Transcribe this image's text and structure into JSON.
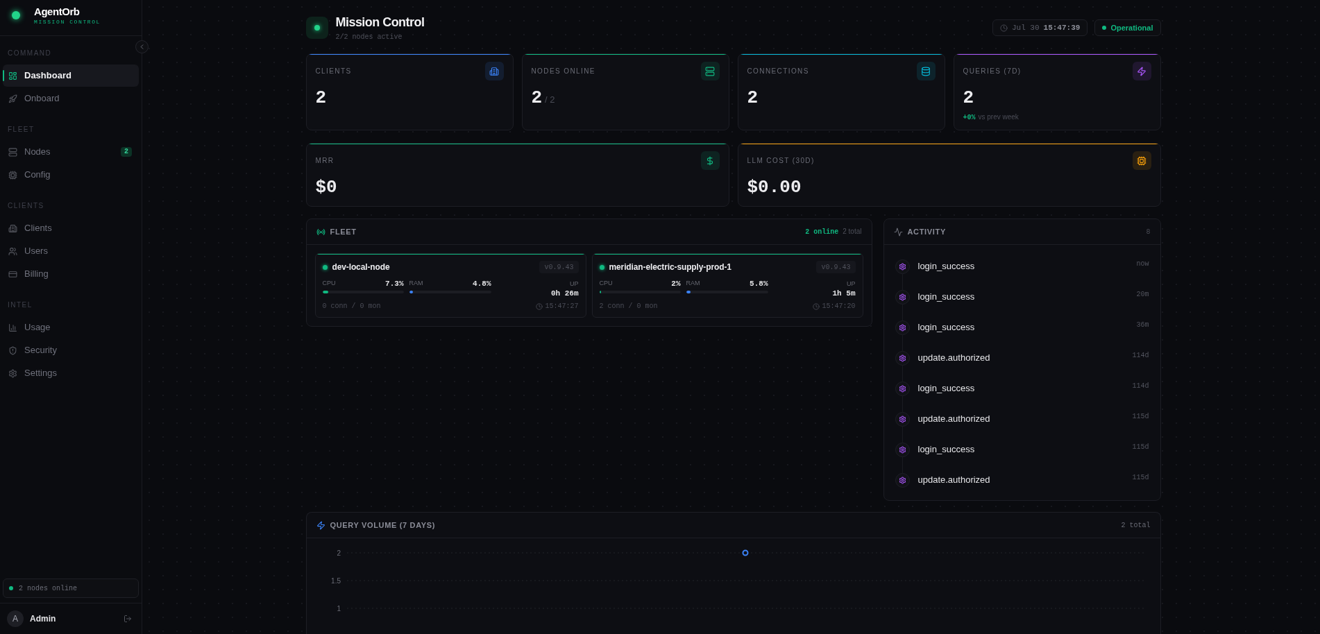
{
  "sidebar": {
    "brand": {
      "name": "AgentOrb",
      "tagline": "MISSION CONTROL"
    },
    "sections": [
      {
        "title": "COMMAND",
        "items": [
          {
            "label": "Dashboard",
            "selected": true
          },
          {
            "label": "Onboard",
            "selected": false
          }
        ]
      },
      {
        "title": "FLEET",
        "items": [
          {
            "label": "Nodes",
            "selected": false,
            "badge": "2"
          },
          {
            "label": "Config",
            "selected": false
          }
        ]
      },
      {
        "title": "CLIENTS",
        "items": [
          {
            "label": "Clients",
            "selected": false
          },
          {
            "label": "Users",
            "selected": false
          },
          {
            "label": "Billing",
            "selected": false
          }
        ]
      },
      {
        "title": "INTEL",
        "items": [
          {
            "label": "Usage",
            "selected": false
          },
          {
            "label": "Security",
            "selected": false
          },
          {
            "label": "Settings",
            "selected": false
          }
        ]
      }
    ],
    "status": "2 nodes online",
    "user": {
      "initial": "A",
      "name": "Admin"
    }
  },
  "header": {
    "title": "Mission Control",
    "subtitle": "2/2 nodes active",
    "date": "Jul 30",
    "time": "15:47:39",
    "status": "Operational"
  },
  "metrics": [
    {
      "label": "CLIENTS",
      "value": "2",
      "color": "#3b82f6"
    },
    {
      "label": "NODES ONLINE",
      "value": "2",
      "suffix": "/ 2",
      "color": "#10b981"
    },
    {
      "label": "CONNECTIONS",
      "value": "2",
      "color": "#06b6d4"
    },
    {
      "label": "QUERIES (7D)",
      "value": "2",
      "change": "+0%",
      "change_note": "vs prev week",
      "color": "#a855f7"
    }
  ],
  "costs": [
    {
      "label": "MRR",
      "value": "$0",
      "color": "#10b981"
    },
    {
      "label": "LLM COST (30D)",
      "value": "$0.00",
      "color": "#f59e0b"
    }
  ],
  "fleet": {
    "title": "FLEET",
    "online": "2 online",
    "total": "2 total",
    "nodes": [
      {
        "name": "dev-local-node",
        "online": true,
        "version": "v0.9.43",
        "cpu": {
          "label": "CPU",
          "reading": "7.3%",
          "level": 0.073
        },
        "ram": {
          "label": "RAM",
          "reading": "4.8%",
          "level": 0.048
        },
        "uptime": {
          "label": "UP",
          "reading": "0h 26m"
        },
        "usage": "0 conn / 0 mon",
        "last_seen": "15:47:27"
      },
      {
        "name": "meridian-electric-supply-prod-1",
        "online": true,
        "version": "v0.9.43",
        "cpu": {
          "label": "CPU",
          "reading": "2%",
          "level": 0.02
        },
        "ram": {
          "label": "RAM",
          "reading": "5.8%",
          "level": 0.058
        },
        "uptime": {
          "label": "UP",
          "reading": "1h 5m"
        },
        "usage": "2 conn / 0 mon",
        "last_seen": "15:47:20"
      }
    ]
  },
  "activity": {
    "title": "ACTIVITY",
    "count": "8",
    "events": [
      {
        "name": "login_success",
        "time": "now"
      },
      {
        "name": "login_success",
        "time": "20m"
      },
      {
        "name": "login_success",
        "time": "36m"
      },
      {
        "name": "update.authorized",
        "time": "114d"
      },
      {
        "name": "login_success",
        "time": "114d"
      },
      {
        "name": "update.authorized",
        "time": "115d"
      },
      {
        "name": "login_success",
        "time": "115d"
      },
      {
        "name": "update.authorized",
        "time": "115d"
      }
    ]
  },
  "query_volume": {
    "title": "QUERY VOLUME (7 DAYS)",
    "total": "2 total",
    "chart_data": {
      "type": "line",
      "marker": "circle",
      "ylim": [
        1,
        2
      ],
      "yticks": [
        1,
        1.5,
        2
      ],
      "values": [
        2
      ]
    }
  }
}
